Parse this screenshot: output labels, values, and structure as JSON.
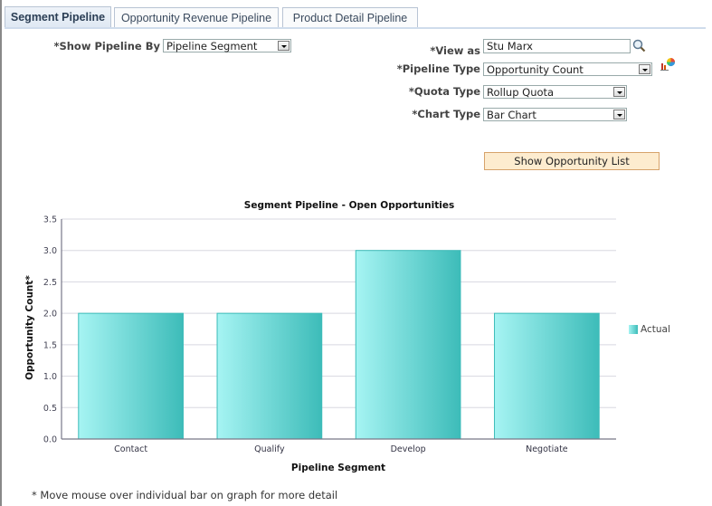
{
  "tabs": [
    {
      "label": "Segment Pipeline",
      "active": true
    },
    {
      "label": "Opportunity Revenue Pipeline",
      "active": false
    },
    {
      "label": "Product Detail Pipeline",
      "active": false
    }
  ],
  "form": {
    "show_pipeline_by": {
      "label": "*Show Pipeline By",
      "value": "Pipeline Segment"
    },
    "view_as": {
      "label": "*View as",
      "value": "Stu Marx"
    },
    "pipeline_type": {
      "label": "*Pipeline Type",
      "value": "Opportunity Count"
    },
    "quota_type": {
      "label": "*Quota Type",
      "value": "Rollup Quota"
    },
    "chart_type": {
      "label": "*Chart Type",
      "value": "Bar Chart"
    }
  },
  "buttons": {
    "show_opportunity_list": "Show Opportunity List"
  },
  "footnote": "* Move mouse over individual bar on graph for more detail",
  "chart_data": {
    "type": "bar",
    "title": "Segment Pipeline - Open Opportunities",
    "xlabel": "Pipeline Segment",
    "ylabel": "Opportunity Count*",
    "categories": [
      "Contact",
      "Qualify",
      "Develop",
      "Negotiate"
    ],
    "series": [
      {
        "name": "Actual",
        "values": [
          2,
          2,
          3,
          2
        ],
        "color": "#3fbfbd"
      }
    ],
    "ylim": [
      0,
      3.5
    ],
    "yticks": [
      "0.0",
      "0.5",
      "1.0",
      "1.5",
      "2.0",
      "2.5",
      "3.0",
      "3.5"
    ],
    "grid": true,
    "legend": "right"
  }
}
